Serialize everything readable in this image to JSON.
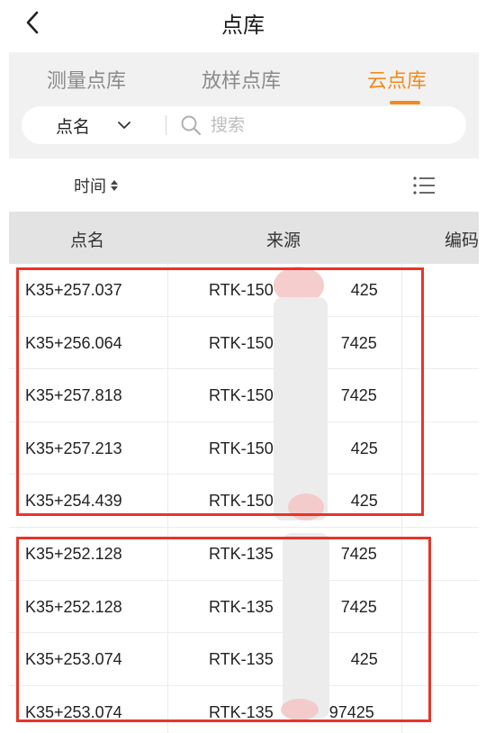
{
  "header": {
    "title": "点库"
  },
  "tabs": [
    {
      "label": "测量点库",
      "active": false
    },
    {
      "label": "放样点库",
      "active": false
    },
    {
      "label": "云点库",
      "active": true
    }
  ],
  "search": {
    "field": "点名",
    "placeholder": "搜索"
  },
  "sort": {
    "label": "时间"
  },
  "table": {
    "columns": [
      "点名",
      "来源",
      "编码"
    ],
    "rows": [
      {
        "name": "K35+257.037",
        "source": "RTK-150",
        "source_tail": "425"
      },
      {
        "name": "K35+256.064",
        "source": "RTK-150",
        "source_tail": "7425"
      },
      {
        "name": "K35+257.818",
        "source": "RTK-150",
        "source_tail": "7425"
      },
      {
        "name": "K35+257.213",
        "source": "RTK-150",
        "source_tail": "425"
      },
      {
        "name": "K35+254.439",
        "source": "RTK-150",
        "source_tail": "425"
      },
      {
        "name": "K35+252.128",
        "source": "RTK-135",
        "source_tail": "7425"
      },
      {
        "name": "K35+252.128",
        "source": "RTK-135",
        "source_tail": "7425"
      },
      {
        "name": "K35+253.074",
        "source": "RTK-135",
        "source_tail": "425"
      },
      {
        "name": "K35+253.074",
        "source": "RTK-135",
        "source_tail": "97425"
      }
    ]
  },
  "colors": {
    "accent": "#f28a1c",
    "highlight_border": "#e8342a"
  },
  "icons": {
    "back": "chevron-left-icon",
    "search": "search-icon",
    "dropdown": "chevron-down-icon",
    "sort": "sort-icon",
    "list": "list-icon"
  }
}
